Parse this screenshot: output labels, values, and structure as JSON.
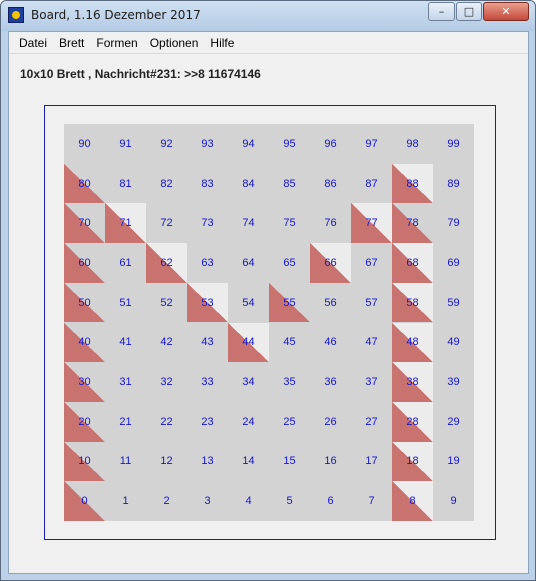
{
  "window": {
    "title": "Board, 1.16 Dezember 2017",
    "controls": {
      "minimize": "–",
      "maximize": "□",
      "close": "✕"
    }
  },
  "menu": [
    "Datei",
    "Brett",
    "Formen",
    "Optionen",
    "Hilfe"
  ],
  "status": "10x10 Brett , Nachricht#231: >>8 11674146",
  "board": {
    "size": 10,
    "marked_cells": [
      0,
      8,
      10,
      18,
      20,
      28,
      30,
      38,
      40,
      44,
      48,
      50,
      53,
      55,
      58,
      60,
      62,
      66,
      68,
      70,
      71,
      77,
      78,
      80,
      88
    ],
    "light_cells": [
      8,
      18,
      28,
      38,
      44,
      48,
      53,
      58,
      62,
      66,
      68,
      71,
      77,
      88
    ],
    "colors": {
      "cell": "#d3d3d3",
      "light_cell": "#ececec",
      "triangle": "#c97370",
      "number": "#1515c8",
      "frame": "#1b1bb0"
    }
  }
}
